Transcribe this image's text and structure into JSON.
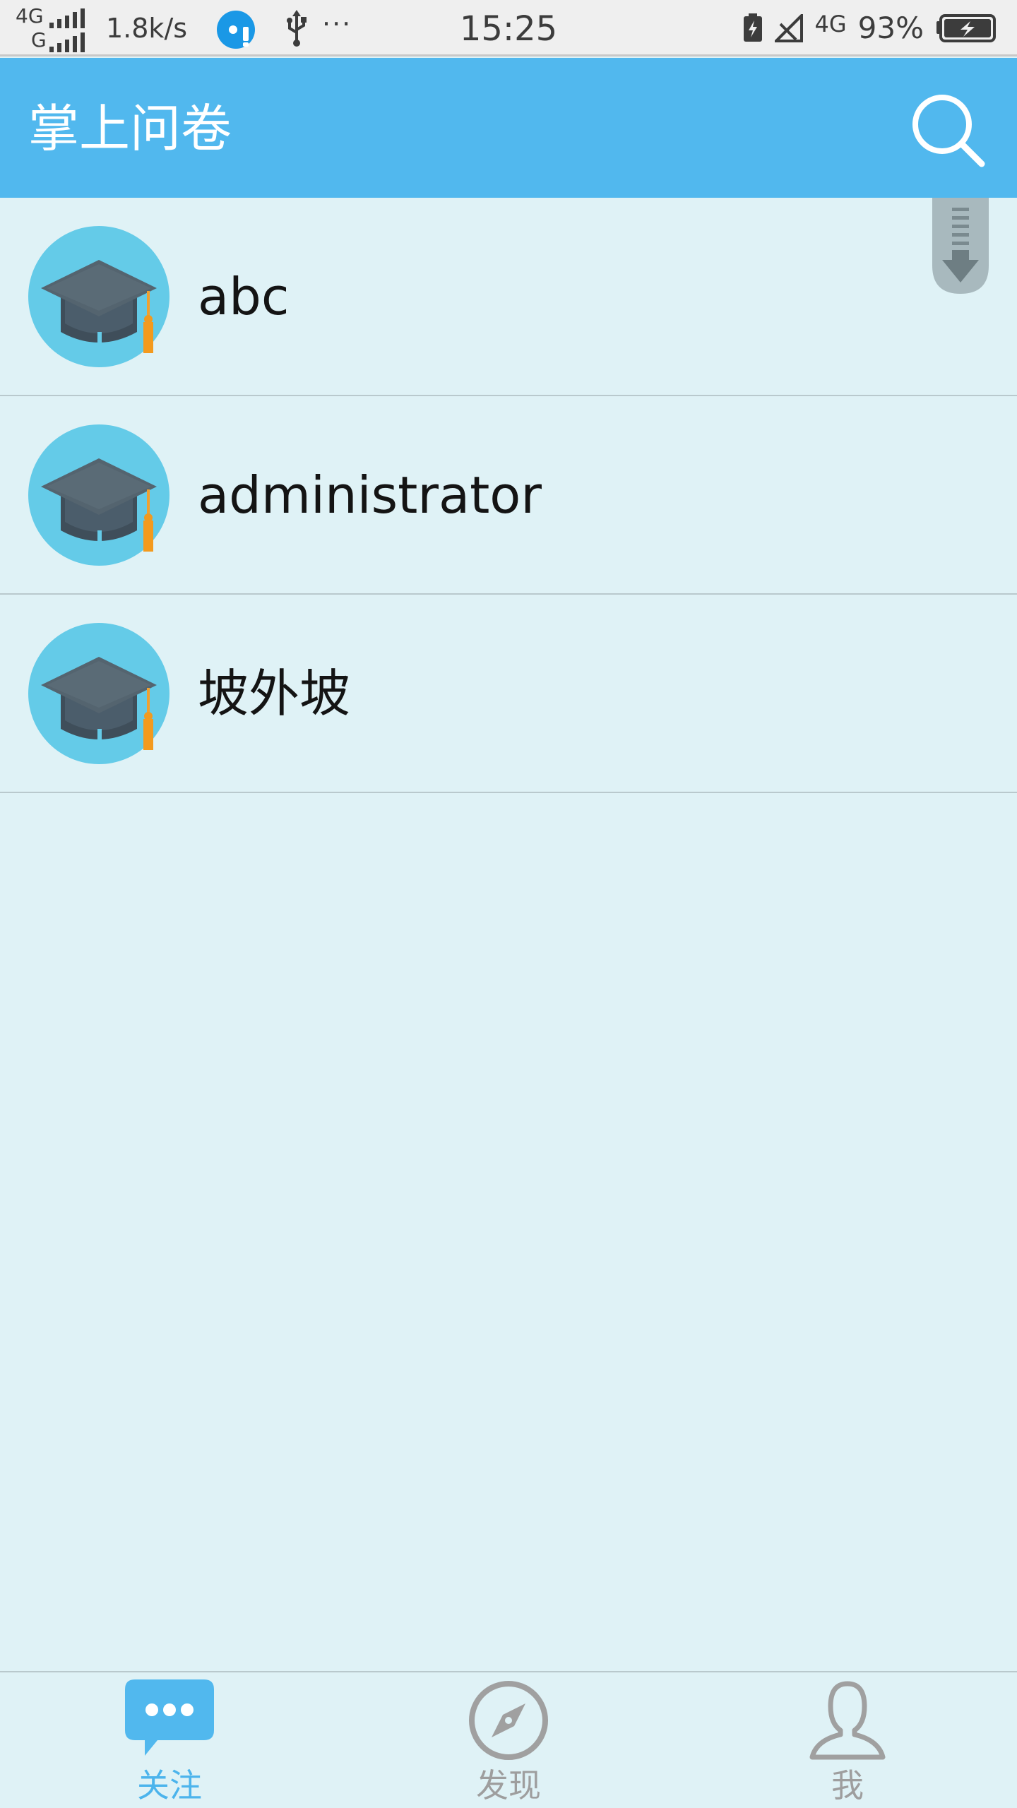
{
  "status_bar": {
    "network_top": "4G",
    "network_bottom": "G",
    "speed": "1.8k/s",
    "more": "···",
    "time": "15:25",
    "network_right": "4G",
    "battery": "93%"
  },
  "header": {
    "title": "掌上问卷",
    "search_icon": "search-icon"
  },
  "list": {
    "items": [
      {
        "label": "abc",
        "icon": "graduation-cap-avatar"
      },
      {
        "label": "administrator",
        "icon": "graduation-cap-avatar"
      },
      {
        "label": "坡外坡",
        "icon": "graduation-cap-avatar"
      }
    ]
  },
  "tabs": [
    {
      "label": "关注",
      "icon": "chat-bubble-icon",
      "active": true
    },
    {
      "label": "发现",
      "icon": "compass-icon",
      "active": false
    },
    {
      "label": "我",
      "icon": "person-icon",
      "active": false
    }
  ],
  "colors": {
    "accent": "#51b8ee",
    "background": "#dff2f6",
    "tab_active": "#4cb4ec",
    "tab_inactive": "#9e9e9e"
  }
}
